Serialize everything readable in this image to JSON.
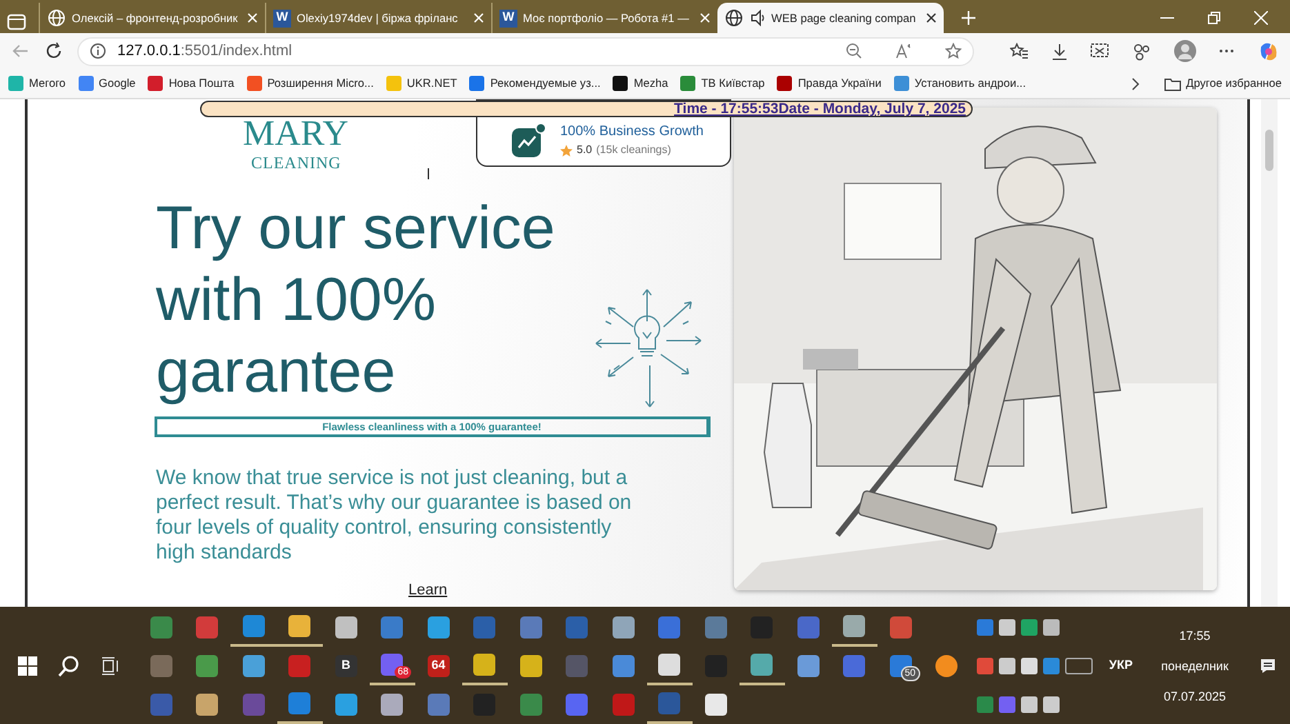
{
  "browser": {
    "tabs": [
      {
        "title": "Олексій – фронтенд-розробник",
        "kind": "globe",
        "selected": false,
        "audio": false
      },
      {
        "title": "Olexiy1974dev | біржа фріланс",
        "kind": "word",
        "icon_label": "W",
        "selected": false,
        "audio": false
      },
      {
        "title": "Моє портфоліо — Робота #1 —",
        "kind": "word",
        "icon_label": "W",
        "selected": false,
        "audio": false
      },
      {
        "title": "WEB page cleaning compan",
        "kind": "globe",
        "selected": true,
        "audio": true
      }
    ],
    "address": {
      "host": "127.0.0.1",
      "rest": ":5501/index.html"
    },
    "bookmarks": [
      "Мегого",
      "Google",
      "Нова Пошта",
      "Розширення Micro...",
      "UKR.NET",
      "Рекомендуемые уз...",
      "Mezha",
      "ТВ Київстар",
      "Правда України",
      "Установить андрои..."
    ],
    "other_favorites": "Другое избранное"
  },
  "page": {
    "clock": "Time - 17:55:53Date - Monday, July 7, 2025",
    "logo": {
      "name": "MARY",
      "tagline": "CLEANING"
    },
    "growth_card": {
      "title": "100% Business Growth",
      "rating": "5.0",
      "count": "(15k cleanings)"
    },
    "headline": "Try our service with 100% garantee",
    "banner": "Flawless cleanliness with a 100% guarantee!",
    "paragraph": "We know that true service is not just cleaning, but a perfect result. That’s why our guarantee is based on four levels of quality control, ensuring consistently high standards",
    "link": "Learn"
  },
  "taskbar": {
    "rows": [
      [
        {
          "running": false
        },
        {
          "running": false
        },
        {
          "running": true
        },
        {
          "running": true
        },
        {
          "running": false
        },
        {
          "running": false
        },
        {
          "running": false
        },
        {
          "running": false
        },
        {
          "running": false
        },
        {
          "running": false
        },
        {
          "running": false
        },
        {
          "running": false
        },
        {
          "running": false
        },
        {
          "running": false
        },
        {
          "running": false
        },
        {
          "running": true
        },
        {
          "running": false
        }
      ],
      [
        {
          "running": false
        },
        {
          "running": false
        },
        {
          "running": false
        },
        {
          "running": false
        },
        {
          "running": false,
          "label": "B"
        },
        {
          "running": true,
          "badge": "68"
        },
        {
          "running": false,
          "label": "64"
        },
        {
          "running": true
        },
        {
          "running": false
        },
        {
          "running": false
        },
        {
          "running": false
        },
        {
          "running": true
        },
        {
          "running": false
        },
        {
          "running": true
        },
        {
          "running": false
        },
        {
          "running": false
        },
        {
          "running": false,
          "badge": "50"
        },
        {
          "running": false
        }
      ],
      [
        {
          "running": false
        },
        {
          "running": false
        },
        {
          "running": false
        },
        {
          "running": true
        },
        {
          "running": false
        },
        {
          "running": false
        },
        {
          "running": false
        },
        {
          "running": false
        },
        {
          "running": false
        },
        {
          "running": false
        },
        {
          "running": false
        },
        {
          "running": true
        },
        {
          "running": false
        }
      ]
    ],
    "language": "УКР",
    "time": "17:55",
    "weekday": "понеделник",
    "date": "07.07.2025"
  }
}
